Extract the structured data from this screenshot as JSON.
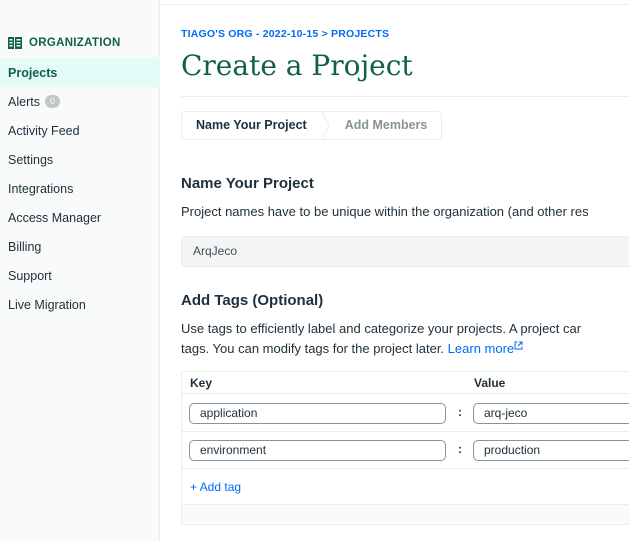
{
  "sidebar": {
    "org_label": "ORGANIZATION",
    "org_icon": "building-icon",
    "items": [
      {
        "label": "Projects",
        "active": true
      },
      {
        "label": "Alerts",
        "badge": "0"
      },
      {
        "label": "Activity Feed"
      },
      {
        "label": "Settings"
      },
      {
        "label": "Integrations"
      },
      {
        "label": "Access Manager"
      },
      {
        "label": "Billing"
      },
      {
        "label": "Support"
      },
      {
        "label": "Live Migration"
      }
    ]
  },
  "main": {
    "breadcrumb": "TIAGO'S ORG - 2022-10-15 > PROJECTS",
    "title": "Create a Project",
    "steps": [
      {
        "label": "Name Your Project",
        "state": "current"
      },
      {
        "label": "Add Members",
        "state": "upcoming"
      }
    ],
    "name_section": {
      "heading": "Name Your Project",
      "description": "Project names have to be unique within the organization (and other res",
      "input_value": "ArqJeco"
    },
    "tags_section": {
      "heading": "Add Tags (Optional)",
      "description_line1": "Use tags to efficiently label and categorize your projects. A project car",
      "description_line2": "tags. You can modify tags for the project later.",
      "learn_more": "Learn more",
      "columns": {
        "key": "Key",
        "value": "Value"
      },
      "separator": ":",
      "rows": [
        {
          "key": "application",
          "value": "arq-jeco"
        },
        {
          "key": "environment",
          "value": "production"
        }
      ],
      "add_tag": "+ Add tag"
    }
  },
  "colors": {
    "brand_green": "#116149",
    "link_blue": "#016bf8",
    "active_bg": "#e3fcf7"
  }
}
